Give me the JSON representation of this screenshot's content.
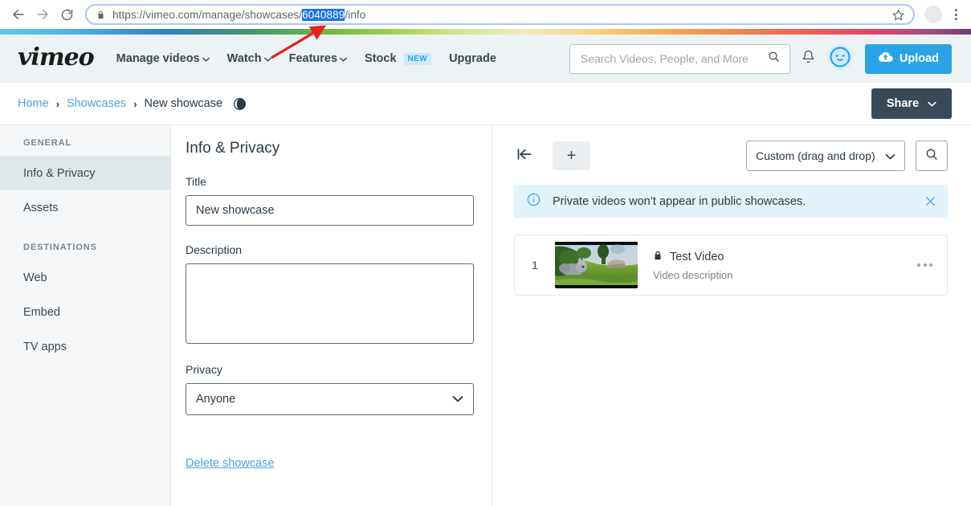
{
  "browser": {
    "back_icon": "back-arrow-icon",
    "forward_icon": "forward-arrow-icon",
    "reload_icon": "reload-icon",
    "lock_icon": "lock-icon",
    "url_prefix": "https://vimeo.com/manage/showcases/",
    "url_selected": "6040889",
    "url_suffix": "/info",
    "star_icon": "star-icon",
    "menu_icon": "three-dot-menu-icon"
  },
  "header": {
    "logo": "vimeo",
    "nav": [
      {
        "label": "Manage videos",
        "caret": "⌄"
      },
      {
        "label": "Watch",
        "caret": "⌄"
      },
      {
        "label": "Features",
        "caret": "⌄"
      },
      {
        "label": "Stock",
        "badge": "NEW"
      },
      {
        "label": "Upgrade"
      }
    ],
    "search_placeholder": "Search Videos, People, and More",
    "search_value": "",
    "search_icon": "search-icon",
    "bell_icon": "bell-icon",
    "avatar_icon": "smiley-avatar-icon",
    "upload_label": "Upload",
    "upload_icon": "cloud-upload-icon"
  },
  "breadcrumb": {
    "home": "Home",
    "showcases": "Showcases",
    "current": "New showcase",
    "sep": "›",
    "globe_icon": "globe-icon",
    "share_label": "Share",
    "share_caret": "⌄"
  },
  "sidebar": {
    "group_general": "GENERAL",
    "group_destinations": "DESTINATIONS",
    "items_general": [
      {
        "label": "Info & Privacy",
        "active": true
      },
      {
        "label": "Assets",
        "active": false
      }
    ],
    "items_destinations": [
      {
        "label": "Web"
      },
      {
        "label": "Embed"
      },
      {
        "label": "TV apps"
      }
    ]
  },
  "form": {
    "title": "Info & Privacy",
    "title_label": "Title",
    "title_value": "New showcase",
    "description_label": "Description",
    "description_value": "",
    "privacy_label": "Privacy",
    "privacy_value": "Anyone",
    "privacy_caret": "⌄",
    "delete_label": "Delete showcase"
  },
  "right_panel": {
    "collapse_icon": "collapse-left-icon",
    "add_label": "+",
    "sort_value": "Custom (drag and drop)",
    "sort_caret": "⌄",
    "search_icon": "search-icon",
    "banner": {
      "info_icon": "info-circle-icon",
      "message": "Private videos won’t appear in public showcases.",
      "close_icon": "close-icon"
    },
    "videos": [
      {
        "index": "1",
        "lock_icon": "lock-icon",
        "title": "Test Video",
        "description": "Video description",
        "menu_icon": "more-options-icon"
      }
    ]
  },
  "colors": {
    "accent_blue": "#2aa3e8",
    "link_blue": "#4aa3e0",
    "share_navy": "#3a4956",
    "banner_bg": "#e2f3fc",
    "header_bg": "#edf2f4",
    "sidebar_bg": "#f5f7f8",
    "url_highlight": "#1a73e8",
    "annotation_red": "#e8211c"
  }
}
